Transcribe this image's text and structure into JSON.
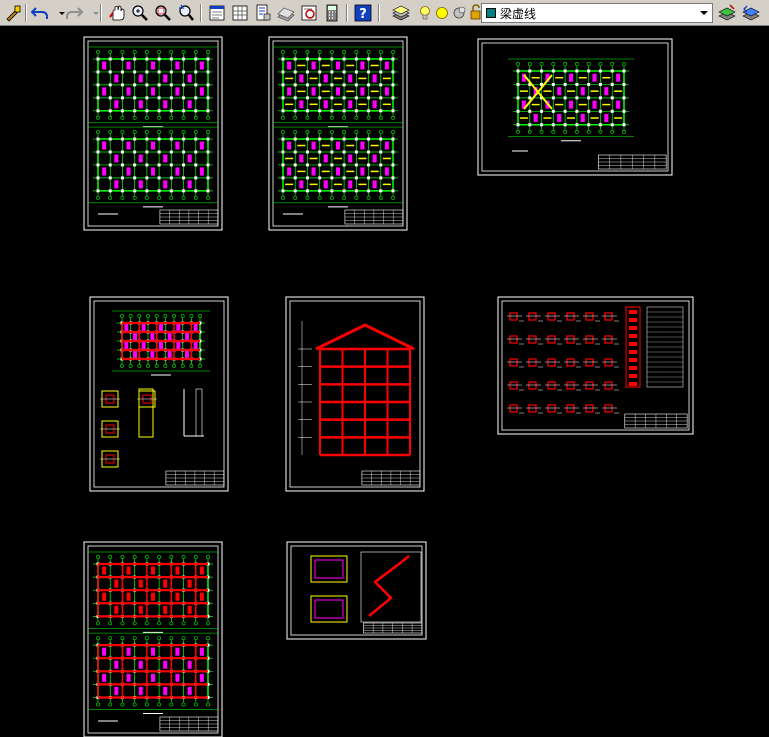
{
  "toolbar": {
    "layer_name": "梁虚线",
    "icons": [
      "match-properties-icon",
      "undo-icon",
      "undo-dropdown-icon",
      "redo-icon",
      "redo-dropdown-icon",
      "pan-icon",
      "zoom-realtime-icon",
      "zoom-window-icon",
      "zoom-previous-icon",
      "properties-icon",
      "design-center-icon",
      "tool-palettes-icon",
      "sheet-set-icon",
      "markup-icon",
      "calculator-icon",
      "help-icon",
      "layer-manager-icon",
      "layer-on-icon",
      "layer-freeze-icon",
      "layer-lock-icon",
      "layer-color-icon",
      "layer-dropdown-icon",
      "make-current-icon",
      "layer-previous-icon"
    ]
  },
  "colors": {
    "background": "#000000",
    "toolbar": "#d4d0c8",
    "green": "#00ff00",
    "magenta": "#ff00ff",
    "yellow": "#ffff00",
    "red": "#ff0000",
    "white": "#ffffff"
  },
  "sheets": [
    {
      "name": "floor-plan-sheet-1",
      "type": "plan2"
    },
    {
      "name": "floor-plan-sheet-2",
      "type": "plan2"
    },
    {
      "name": "roof-plan-sheet",
      "type": "landscape"
    },
    {
      "name": "foundation-detail-sheet",
      "type": "foundation"
    },
    {
      "name": "section-elevation-sheet",
      "type": "section"
    },
    {
      "name": "column-detail-sheet",
      "type": "details"
    },
    {
      "name": "beam-plan-sheet",
      "type": "plan2red"
    },
    {
      "name": "stair-detail-sheet",
      "type": "stair"
    }
  ]
}
